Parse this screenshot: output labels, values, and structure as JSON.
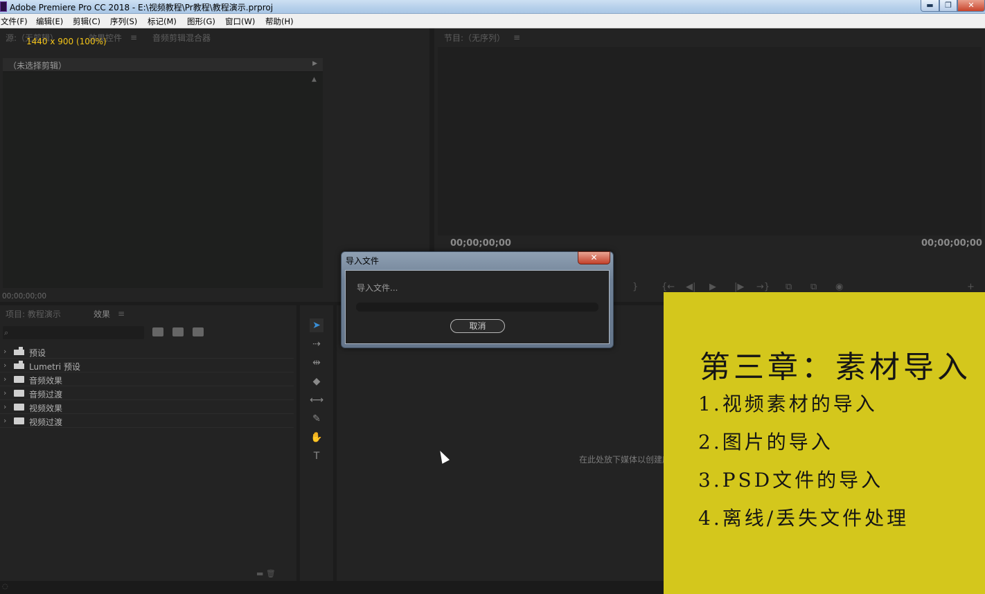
{
  "window": {
    "title": "Adobe Premiere Pro CC 2018 - E:\\视频教程\\Pr教程\\教程演示.prproj",
    "min_glyph": "▬",
    "max_glyph": "❐",
    "close_glyph": "✕"
  },
  "menu": [
    "文件(F)",
    "编辑(E)",
    "剪辑(C)",
    "序列(S)",
    "标记(M)",
    "图形(G)",
    "窗口(W)",
    "帮助(H)"
  ],
  "source_panel": {
    "tabs": [
      "源:（无剪辑）",
      "效果控件",
      "音频剪辑混合器"
    ],
    "size_badge": "1440 x 900 (100%)",
    "clip_select": "（未选择剪辑）",
    "timecode": "00;00;00;00"
  },
  "program_panel": {
    "tab": "节目:（无序列）",
    "timecode_left": "00;00;00;00",
    "timecode_right": "00;00;00;00"
  },
  "project_panel": {
    "tabs": [
      "项目: 教程演示",
      "效果"
    ],
    "tree": [
      {
        "label": "预设",
        "icon": "preset-folder-icon"
      },
      {
        "label": "Lumetri 预设",
        "icon": "preset-folder-icon"
      },
      {
        "label": "音频效果",
        "icon": "folder-icon"
      },
      {
        "label": "音频过渡",
        "icon": "folder-icon"
      },
      {
        "label": "视频效果",
        "icon": "folder-icon"
      },
      {
        "label": "视频过渡",
        "icon": "folder-icon"
      }
    ]
  },
  "timeline": {
    "drop_hint": "在此处放下媒体以创建序列。"
  },
  "dialog": {
    "title": "导入文件",
    "message": "导入文件...",
    "cancel_label": "取消",
    "close_glyph": "✕"
  },
  "overlay": {
    "background": "#d4c71c",
    "title": "第三章：素材导入",
    "items": [
      "1.视频素材的导入",
      "2.图片的导入",
      "3.PSD文件的导入",
      "4.离线/丢失文件处理"
    ]
  }
}
